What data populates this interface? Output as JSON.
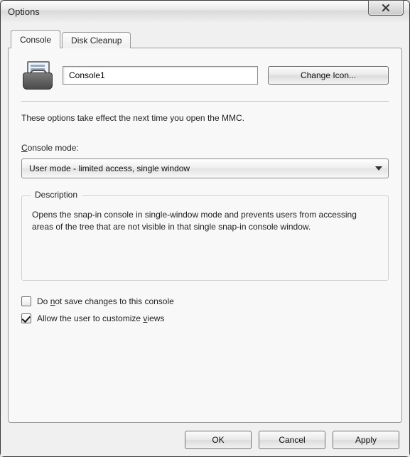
{
  "window": {
    "title": "Options"
  },
  "tabs": [
    {
      "label": "Console"
    },
    {
      "label": "Disk Cleanup"
    }
  ],
  "header": {
    "console_name": "Console1",
    "change_icon_label": "Change Icon..."
  },
  "intro": "These options take effect the next time you open the MMC.",
  "console_mode": {
    "label_pre": "C",
    "label_post": "onsole mode:",
    "selected": "User mode - limited access, single window"
  },
  "description": {
    "legend": "Description",
    "text": "Opens the snap-in console in single-window mode and prevents users from accessing areas of the tree that are not visible in that single snap-in console window."
  },
  "checkboxes": {
    "dont_save": {
      "label_pre": "Do ",
      "label_u": "n",
      "label_post": "ot save changes to this console",
      "checked": false
    },
    "allow_custom": {
      "label_pre": "Allow the user to customize ",
      "label_u": "v",
      "label_post": "iews",
      "checked": true
    }
  },
  "buttons": {
    "ok": "OK",
    "cancel": "Cancel",
    "apply": "Apply"
  }
}
